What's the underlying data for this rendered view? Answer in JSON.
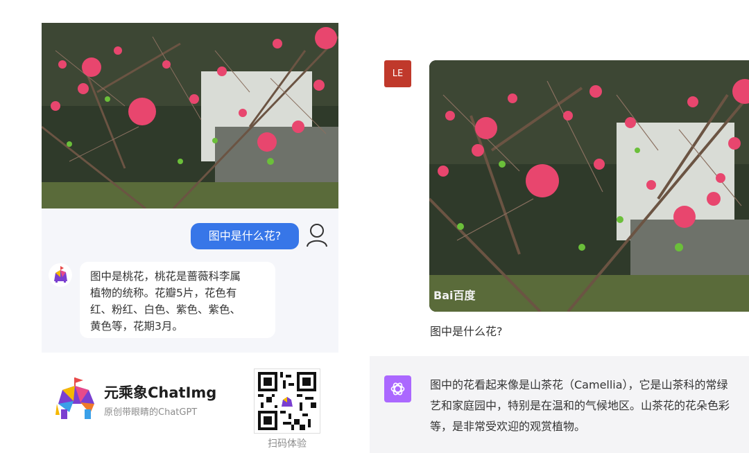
{
  "left_chat": {
    "user_message": "图中是什么花?",
    "bot_lines": [
      "图中是桃花，桃花是蔷薇科李属",
      "植物的统称。花瓣5片，花色有",
      "红、粉红、白色、紫色、紫色、",
      "黄色等，花期3月。"
    ]
  },
  "brand": {
    "name": "元乘象ChatImg",
    "tagline": "原创带眼睛的ChatGPT",
    "qr_caption": "扫码体验"
  },
  "right_chat": {
    "user_initials": "LE",
    "question": "图中是什么花?",
    "answer_lines": [
      "图中的花看起来像是山茶花（Camellia），它是山茶科的常绿",
      "艺和家庭园中，特别是在温和的气候地区。山茶花的花朵色彩",
      "等，是非常受欢迎的观赏植物。"
    ]
  },
  "photo": {
    "watermark": "Bai百度"
  },
  "colors": {
    "user_bubble": "#3776e8",
    "user_badge": "#c0392b",
    "gpt_icon": "#ab68ff",
    "blossom": "#e8466e"
  }
}
